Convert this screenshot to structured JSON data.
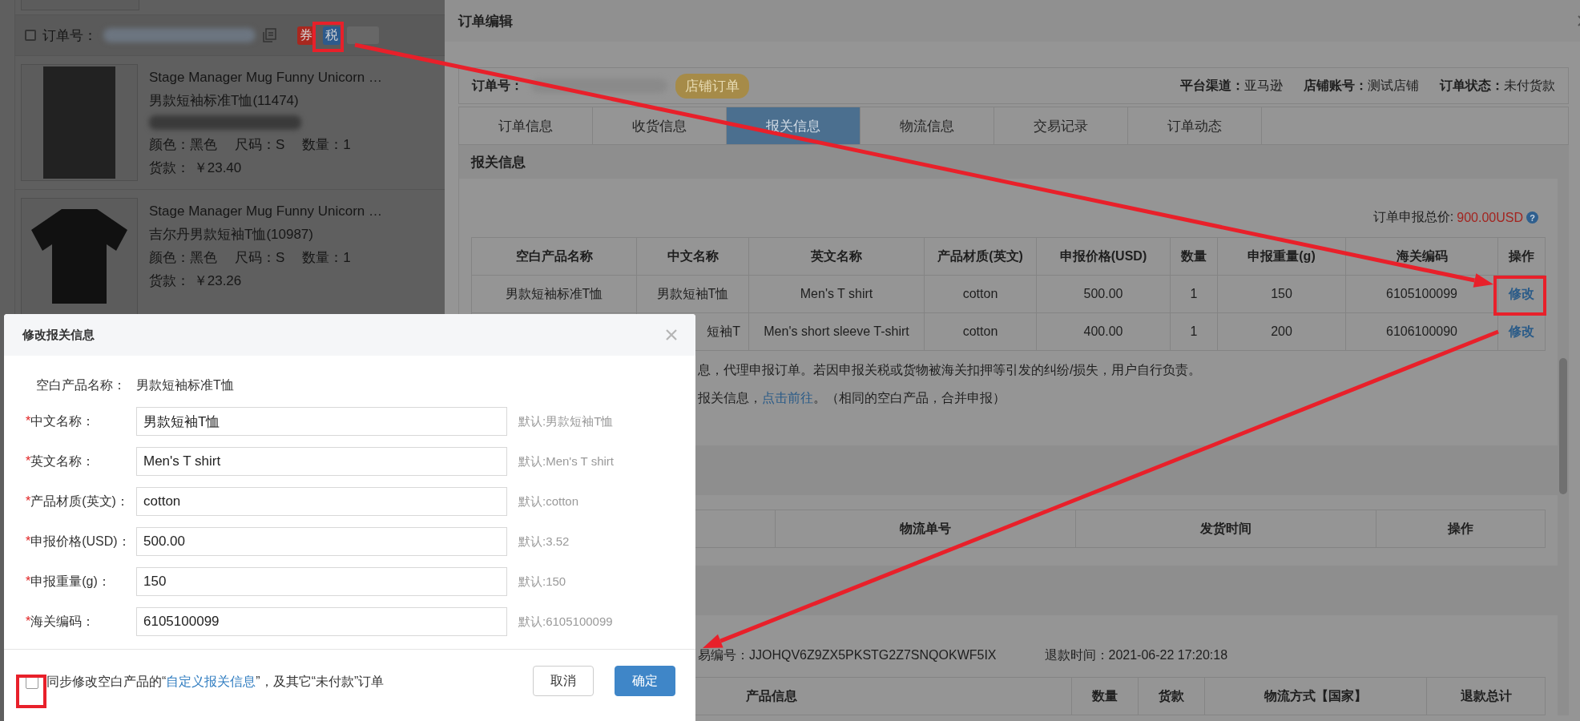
{
  "order_list": {
    "order": {
      "label": "订单号：",
      "checked": false,
      "badges": [
        {
          "label": "券",
          "color": "#a8281f"
        },
        {
          "label": "税",
          "color": "#2d5a8c"
        }
      ]
    },
    "products": [
      {
        "kind": "photo",
        "title": "Stage Manager Mug Funny Unicorn …",
        "name": "男款短袖标准T恤(11474)",
        "redacted_line": true,
        "specs": [
          "颜色：黑色",
          "尺码：S",
          "数量：1"
        ],
        "price_label": "货款：",
        "price": "￥23.40"
      },
      {
        "kind": "tshirt",
        "title": "Stage Manager Mug Funny Unicorn …",
        "name": "吉尔丹男款短袖T恤(10987)",
        "redacted_line": false,
        "specs": [
          "颜色：黑色",
          "尺码：S",
          "数量：1"
        ],
        "price_label": "货款：",
        "price": "￥23.26"
      }
    ]
  },
  "order_edit": {
    "title": "订单编辑",
    "order_label": "订单号：",
    "order_type": "店铺订单",
    "meta": [
      {
        "label": "平台渠道：",
        "value": "亚马逊"
      },
      {
        "label": "店铺账号：",
        "value": "测试店铺"
      },
      {
        "label": "订单状态：",
        "value": "未付货款"
      }
    ],
    "tabs": [
      {
        "label": "订单信息",
        "selected": false
      },
      {
        "label": "收货信息",
        "selected": false
      },
      {
        "label": "报关信息",
        "selected": true
      },
      {
        "label": "物流信息",
        "selected": false
      },
      {
        "label": "交易记录",
        "selected": false
      },
      {
        "label": "订单动态",
        "selected": false
      }
    ],
    "customs": {
      "title": "报关信息",
      "total_label": "订单申报总价:",
      "total_value": "900.00USD",
      "help": "?",
      "columns": [
        "空白产品名称",
        "中文名称",
        "英文名称",
        "产品材质(英文)",
        "申报价格(USD)",
        "数量",
        "申报重量(g)",
        "海关编码",
        "操作"
      ],
      "rows": [
        {
          "cells": [
            "男款短袖标准T恤",
            "男款短袖T恤",
            "Men's T shirt",
            "cotton",
            "500.00",
            "1",
            "150",
            "6105100099"
          ],
          "action": "修改"
        },
        {
          "cells": [
            null,
            "短袖T",
            "Men's short sleeve T-shirt",
            "cotton",
            "400.00",
            "1",
            "200",
            "6106100090"
          ],
          "action": "修改"
        }
      ],
      "notes": [
        {
          "text": "息，代理申报订单。若因申报关税或货物被海关扣押等引发的纠纷/损失，用户自行负责。"
        },
        {
          "text": "报关信息，",
          "link": "点击前往",
          "text_after": "。（相同的空白产品，合并申报）"
        }
      ]
    },
    "logistics": {
      "columns": [
        null,
        "物流单号",
        "发货时间",
        "操作"
      ]
    },
    "refund": {
      "trade_no": "易编号：JJOHQV6Z9ZX5PKSTG2Z7SNQOKWF5IX",
      "refund_time": "退款时间：2021-06-22 17:20:18",
      "columns": [
        "产品信息",
        "数量",
        "货款",
        "物流方式【国家】",
        "退款总计"
      ]
    }
  },
  "dialog": {
    "title": "修改报关信息",
    "product_label": "空白产品名称：",
    "product_value": "男款短袖标准T恤",
    "required_mark": "*",
    "fields": [
      {
        "label": "中文名称：",
        "required": true,
        "value": "男款短袖T恤",
        "hint": "默认:男款短袖T恤"
      },
      {
        "label": "英文名称：",
        "required": true,
        "value": "Men's T shirt",
        "hint": "默认:Men's T shirt"
      },
      {
        "label": "产品材质(英文)：",
        "required": true,
        "value": "cotton",
        "hint": "默认:cotton"
      },
      {
        "label": "申报价格(USD)：",
        "required": true,
        "value": "500.00",
        "hint": "默认:3.52"
      },
      {
        "label": "申报重量(g)：",
        "required": true,
        "value": "150",
        "hint": "默认:150"
      },
      {
        "label": "海关编码：",
        "required": true,
        "value": "6105100099",
        "hint": "默认:6105100099"
      }
    ],
    "sync": {
      "checked": false,
      "text_before": "同步修改空白产品的“",
      "link": "自定义报关信息",
      "text_after": "”，及其它“未付款”订单"
    },
    "buttons": [
      {
        "label": "取消",
        "kind": "default"
      },
      {
        "label": "确定",
        "kind": "primary"
      }
    ]
  }
}
